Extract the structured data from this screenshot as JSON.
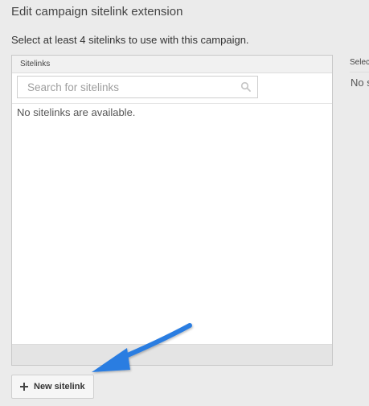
{
  "dialog": {
    "title": "Edit campaign sitelink extension",
    "instruction": "Select at least 4 sitelinks to use with this campaign."
  },
  "sitelinks_panel": {
    "header": "Sitelinks",
    "search_placeholder": "Search for sitelinks",
    "empty_message": "No sitelinks are available."
  },
  "selected_panel": {
    "header_visible": "Selec",
    "empty_visible": "No s"
  },
  "actions": {
    "new_sitelink_label": "New sitelink"
  },
  "annotation": {
    "arrow_color": "#2a7de1"
  },
  "icons": {
    "search": "search-icon",
    "plus": "plus-icon"
  }
}
